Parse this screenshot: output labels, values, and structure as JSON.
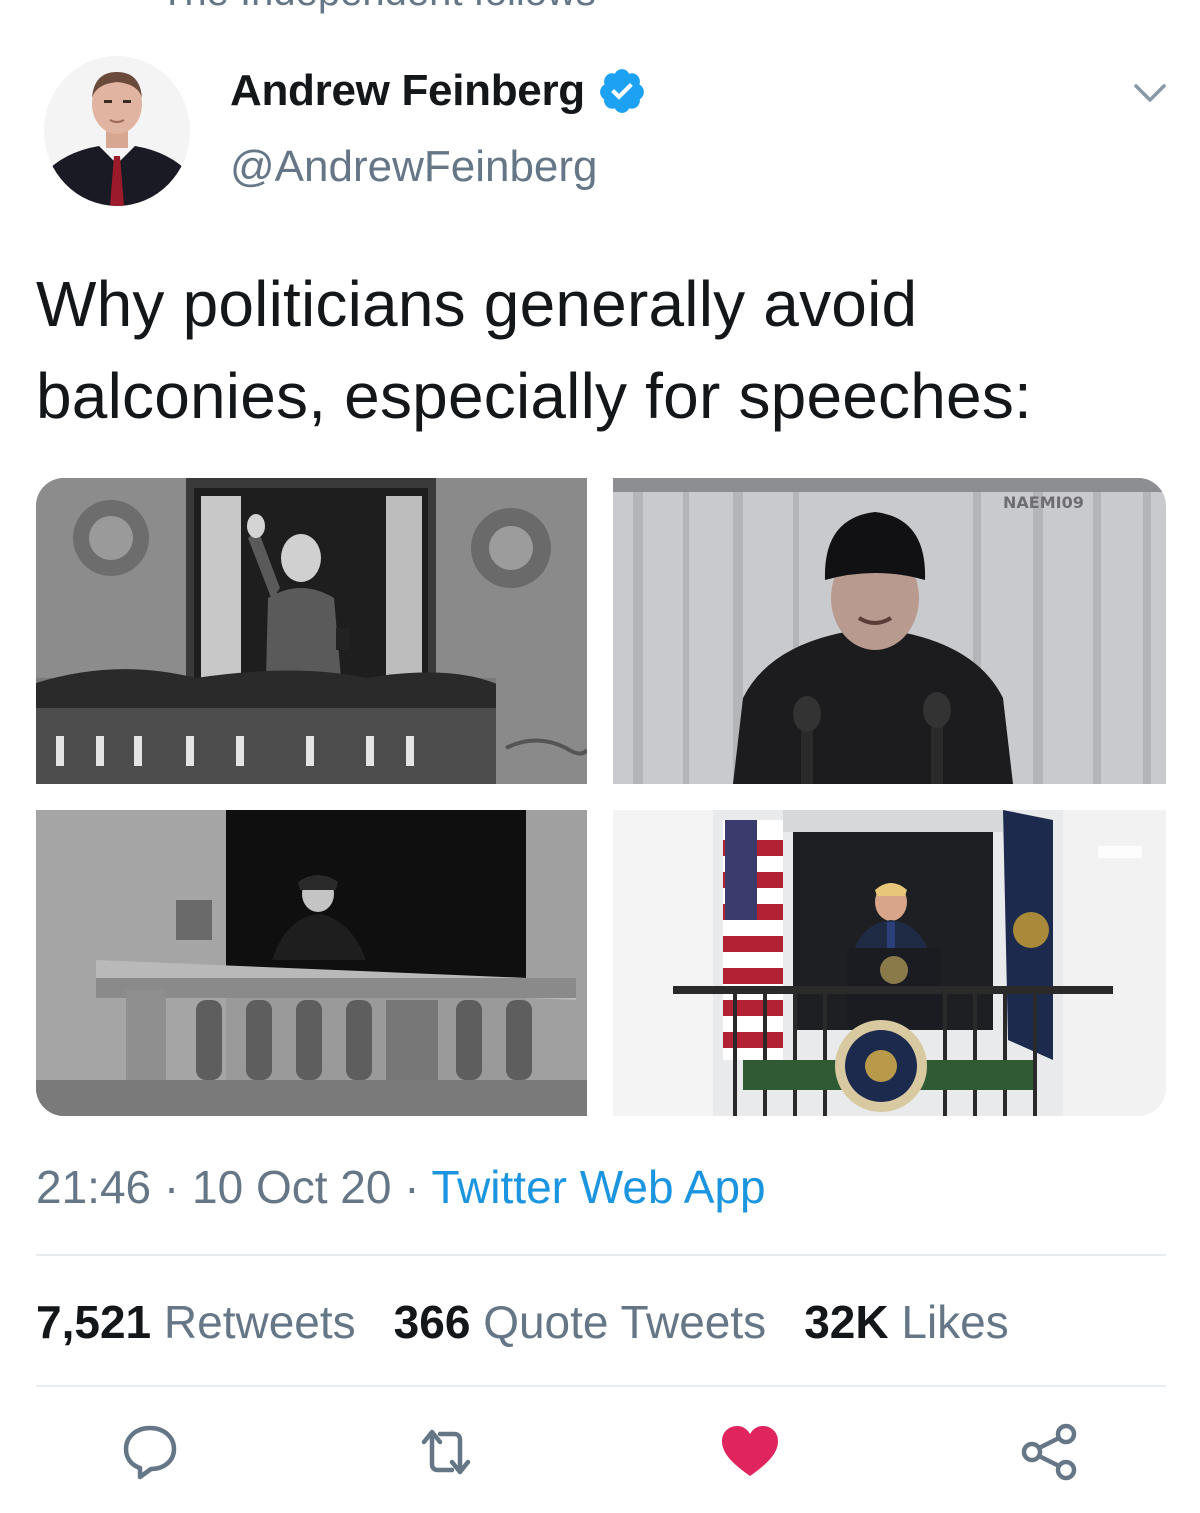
{
  "context": {
    "text": "The Independent follows"
  },
  "author": {
    "name": "Andrew Feinberg",
    "handle": "@AndrewFeinberg",
    "verified": true
  },
  "tweet": {
    "text_line1": "Why politicians generally avoid",
    "text_line2": "balconies, especially for speeches:"
  },
  "media": {
    "photos": [
      {
        "description_id": "photo-1"
      },
      {
        "description_id": "photo-2",
        "watermark": "NAEMI09"
      },
      {
        "description_id": "photo-3"
      },
      {
        "description_id": "photo-4"
      }
    ]
  },
  "meta": {
    "time": "21:46",
    "separator": " · ",
    "date": "10 Oct 20",
    "source": "Twitter Web App"
  },
  "stats": {
    "retweets_count": "7,521",
    "retweets_label": "Retweets",
    "quotes_count": "366",
    "quotes_label": "Quote Tweets",
    "likes_count": "32K",
    "likes_label": "Likes"
  },
  "colors": {
    "accent": "#1b95e0",
    "verified": "#1da1f2",
    "like": "#e0245e",
    "text_secondary": "#657786"
  },
  "icons": {
    "reply": "reply-icon",
    "retweet": "retweet-icon",
    "like": "heart-icon",
    "share": "share-icon",
    "more": "chevron-down-icon",
    "verified": "verified-badge-icon"
  }
}
